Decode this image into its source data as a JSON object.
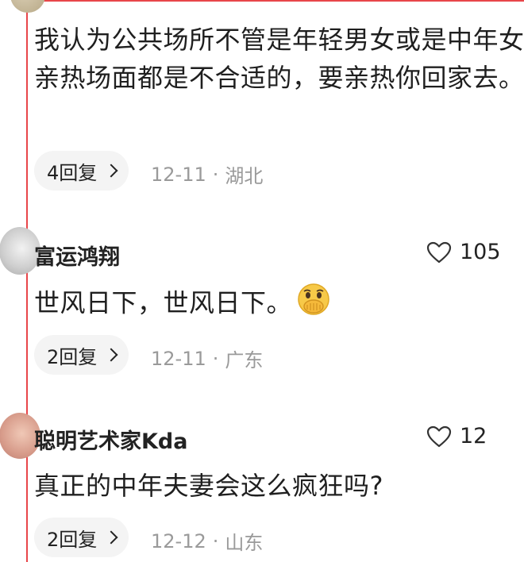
{
  "comments": [
    {
      "text": "我认为公共场所不管是年轻男女或是中年女亲热场面都是不合适的，要亲热你回家去。",
      "reply_label": "4回复",
      "date": "12-11",
      "location": "湖北"
    },
    {
      "username": "富运鸿翔",
      "likes": "105",
      "text": "世风日下，世风日下。",
      "emoji_icon": "hand-over-mouth-emoji-icon",
      "reply_label": "2回复",
      "date": "12-11",
      "location": "广东"
    },
    {
      "username": "聪明艺术家Kda",
      "likes": "12",
      "text": "真正的中年夫妻会这么疯狂吗?",
      "reply_label": "2回复",
      "date": "12-12",
      "location": "山东"
    }
  ],
  "meta_separator": "·",
  "colors": {
    "highlight_border": "#e8464a",
    "meta_text": "#9a9a9a",
    "pill_bg": "#f4f4f4"
  }
}
